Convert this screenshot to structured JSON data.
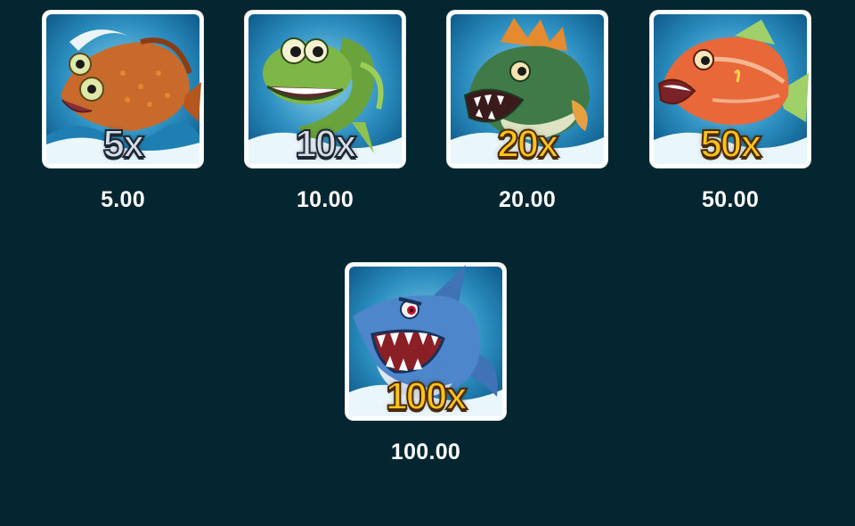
{
  "paytable": {
    "symbols": [
      {
        "multiplier": "5x",
        "payout": "5.00",
        "creature": "flounder-fish",
        "badge_style": "silver"
      },
      {
        "multiplier": "10x",
        "payout": "10.00",
        "creature": "green-eel",
        "badge_style": "silver"
      },
      {
        "multiplier": "20x",
        "payout": "20.00",
        "creature": "green-bass",
        "badge_style": "gold"
      },
      {
        "multiplier": "50x",
        "payout": "50.00",
        "creature": "red-snapper",
        "badge_style": "gold"
      },
      {
        "multiplier": "100x",
        "payout": "100.00",
        "creature": "blue-shark",
        "badge_style": "gold"
      }
    ]
  },
  "colors": {
    "background": "#042631",
    "tile_border": "#ffffff",
    "silver_badge": "#d7dde6",
    "gold_badge": "#ffc21a",
    "payout_text": "#ffffff"
  }
}
